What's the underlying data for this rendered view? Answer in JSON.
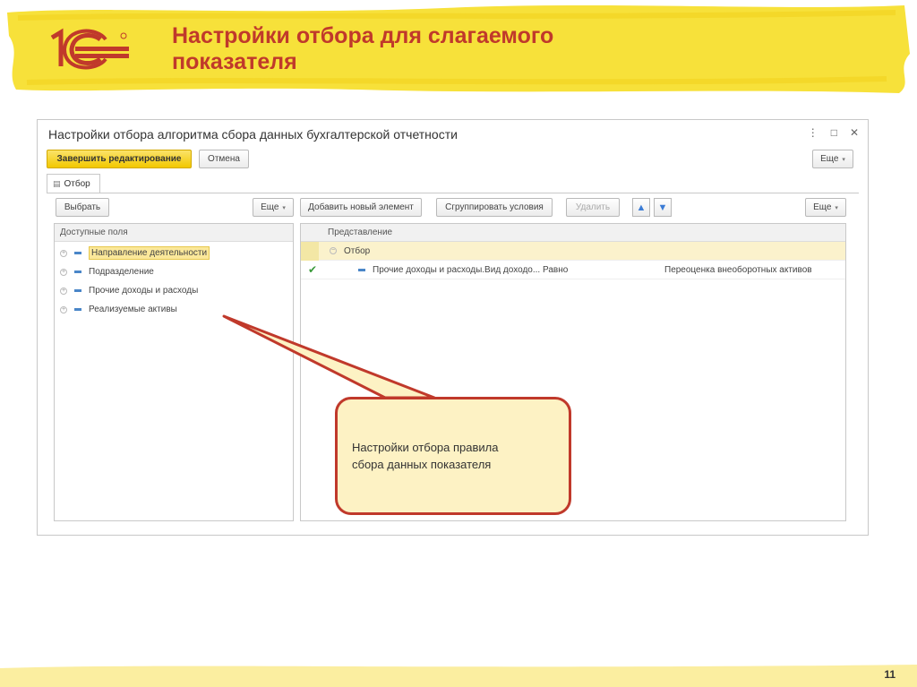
{
  "slide": {
    "title": "Настройки отбора для слагаемого показателя",
    "page_number": "11",
    "logo_text": "1С"
  },
  "window": {
    "title": "Настройки отбора алгоритма сбора данных бухгалтерской отчетности",
    "controls": [
      "⋮",
      "□",
      "✕"
    ],
    "toolbar": {
      "finish_label": "Завершить редактирование",
      "cancel_label": "Отмена",
      "more_label": "Еще"
    },
    "tab_label": "Отбор"
  },
  "left_panel": {
    "select_label": "Выбрать",
    "more_label": "Еще",
    "header": "Доступные поля",
    "items": [
      {
        "label": "Направление деятельности",
        "selected": true
      },
      {
        "label": "Подразделение",
        "selected": false
      },
      {
        "label": "Прочие доходы и расходы",
        "selected": false
      },
      {
        "label": "Реализуемые активы",
        "selected": false
      }
    ]
  },
  "right_panel": {
    "add_label": "Добавить новый элемент",
    "group_label": "Сгруппировать условия",
    "delete_label": "Удалить",
    "more_label": "Еще",
    "header": "Представление",
    "group_row": "Отбор",
    "condition": {
      "checked": true,
      "field": "Прочие доходы и расходы.Вид доходо...",
      "comparison": "Равно",
      "value": "Переоценка внеоборотных активов"
    }
  },
  "callout": {
    "text_line1": "Настройки отбора  правила",
    "text_line2": "сбора данных показателя"
  },
  "colors": {
    "accent_red": "#c0392b",
    "banner_yellow": "#f7e13a",
    "button_yellow": "#f2c800"
  }
}
